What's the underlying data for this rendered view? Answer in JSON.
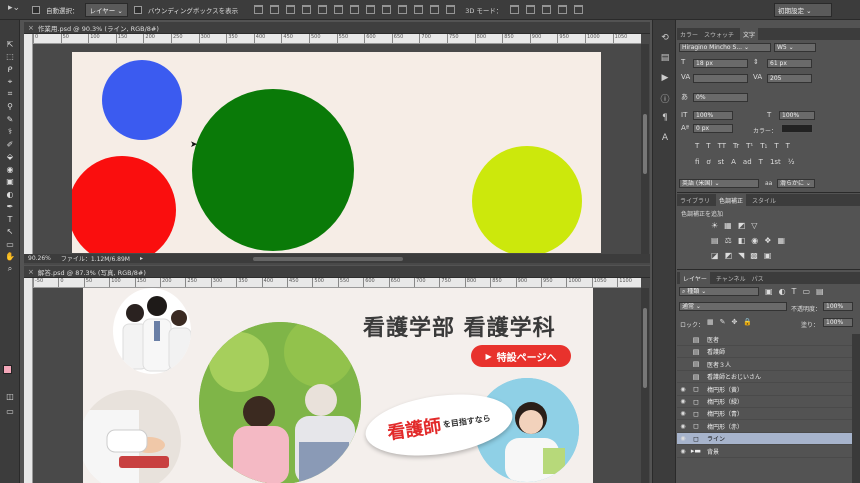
{
  "options_bar": {
    "auto_select_label": "自動選択：",
    "auto_select_target": "レイヤー",
    "bounding_box_label": "バウンディングボックスを表示",
    "mode3d_label": "3D モード：",
    "workspace": "初期設定"
  },
  "tools": [
    "⇱",
    "⬚",
    "ᑭ",
    "⌖",
    "⌗",
    "⚲",
    "✎",
    "⚕",
    "✐",
    "⬙",
    "◉",
    "▣",
    "◐",
    "✒",
    "T",
    "↖",
    "▭",
    "✋",
    "⌕"
  ],
  "colors": {
    "foreground": "#f4a7b9",
    "background": "#ffffff",
    "accent_red": "#e8322d"
  },
  "doc1": {
    "tab_title": "作業用.psd @ 90.3% (ライン, RGB/8#)",
    "ruler_ticks": [
      "0",
      "50",
      "100",
      "150",
      "200",
      "250",
      "300",
      "350",
      "400",
      "450",
      "500",
      "550",
      "600",
      "650",
      "700",
      "750",
      "800",
      "850",
      "900",
      "950",
      "1000",
      "1050"
    ],
    "zoom": "90.26%",
    "file_info": "ファイル：1.12M/6.89M"
  },
  "doc2": {
    "tab_title": "解答.psd @ 87.3% (写真, RGB/8#)",
    "ruler_ticks": [
      "-50",
      "0",
      "50",
      "100",
      "150",
      "200",
      "250",
      "300",
      "350",
      "400",
      "450",
      "500",
      "550",
      "600",
      "650",
      "700",
      "750",
      "800",
      "850",
      "900",
      "950",
      "1000",
      "1050",
      "1100"
    ],
    "banner_title": "看護学部 看護学科",
    "button_label": "特設ページへ",
    "bubble_big": "看護師",
    "bubble_small": "を目指すなら"
  },
  "char_panel": {
    "tabs": [
      "カラー",
      "スウォッチ",
      "文字"
    ],
    "font_family": "Hiragino Mincho S...",
    "font_style": "W5",
    "font_size": "18 px",
    "leading": "61 px",
    "tracking": "205",
    "tsume": "0%",
    "vscale": "100%",
    "hscale": "100%",
    "baseline": "0 px",
    "color_label": "カラー：",
    "type_buttons": [
      "T",
      "T",
      "TT",
      "Tr",
      "T¹",
      "T₁",
      "T",
      "T"
    ],
    "ot_buttons": [
      "fi",
      "ơ",
      "st",
      "A",
      "ad",
      "T",
      "1st",
      "½"
    ],
    "language": "英語 (米国)",
    "aa_icon": "aa",
    "antialias": "滑らかに"
  },
  "adjust_panel": {
    "tabs": [
      "ライブラリ",
      "色調補正",
      "スタイル"
    ],
    "add_label": "色調補正を追加",
    "row1_icons": [
      "☀",
      "▦",
      "◩",
      "▽"
    ],
    "row2_icons": [
      "▤",
      "⚖",
      "◧",
      "◉",
      "❖",
      "▦"
    ],
    "row3_icons": [
      "◪",
      "◩",
      "◥",
      "▩",
      "▣"
    ]
  },
  "layers_panel": {
    "tabs": [
      "レイヤー",
      "チャンネル",
      "パス"
    ],
    "filter_label": "種類",
    "blend_mode": "通常",
    "opacity_label": "不透明度：",
    "opacity_value": "100%",
    "lock_label": "ロック：",
    "fill_label": "塗り：",
    "fill_value": "100%",
    "layers": [
      {
        "name": "医者",
        "visible": false,
        "kind": "smart"
      },
      {
        "name": "看護師",
        "visible": false,
        "kind": "smart"
      },
      {
        "name": "医者３人",
        "visible": false,
        "kind": "smart"
      },
      {
        "name": "看護師とおじいさん",
        "visible": false,
        "kind": "smart"
      },
      {
        "name": "楕円形（黄）",
        "visible": true,
        "kind": "shape"
      },
      {
        "name": "楕円形（緑）",
        "visible": true,
        "kind": "shape"
      },
      {
        "name": "楕円形（青）",
        "visible": true,
        "kind": "shape"
      },
      {
        "name": "楕円形（赤）",
        "visible": true,
        "kind": "shape"
      },
      {
        "name": "ライン",
        "visible": true,
        "kind": "shape",
        "selected": true
      },
      {
        "name": "背景",
        "visible": true,
        "kind": "folder"
      }
    ]
  }
}
